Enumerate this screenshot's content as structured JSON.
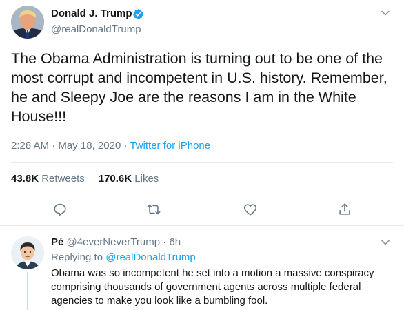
{
  "tweet": {
    "author_name": "Donald J. Trump",
    "author_handle": "@realDonaldTrump",
    "verified_icon": "verified-badge-icon",
    "text": "The Obama Administration is turning out to be one of the most corrupt and incompetent in U.S. history. Remember, he and Sleepy Joe are the reasons I am in the White House!!!",
    "time": "2:28 AM",
    "date": "May 18, 2020",
    "separator": "·",
    "source": "Twitter for iPhone",
    "retweets_count": "43.8K",
    "retweets_label": "Retweets",
    "likes_count": "170.6K",
    "likes_label": "Likes",
    "actions": [
      "reply-icon",
      "retweet-icon",
      "like-icon",
      "share-icon"
    ]
  },
  "reply": {
    "author_name": "Pé",
    "author_handle": "@4everNeverTrump",
    "separator": "·",
    "time": "6h",
    "replying_prefix": "Replying to",
    "replying_to": "@realDonaldTrump",
    "text": "Obama was so incompetent he set into a motion a massive conspiracy comprising thousands of government agents across multiple federal agencies to make you look like a bumbling fool."
  },
  "colors": {
    "accent": "#1da1f2",
    "text_primary": "#14171a",
    "text_secondary": "#657786",
    "border": "#e6ecf0"
  }
}
